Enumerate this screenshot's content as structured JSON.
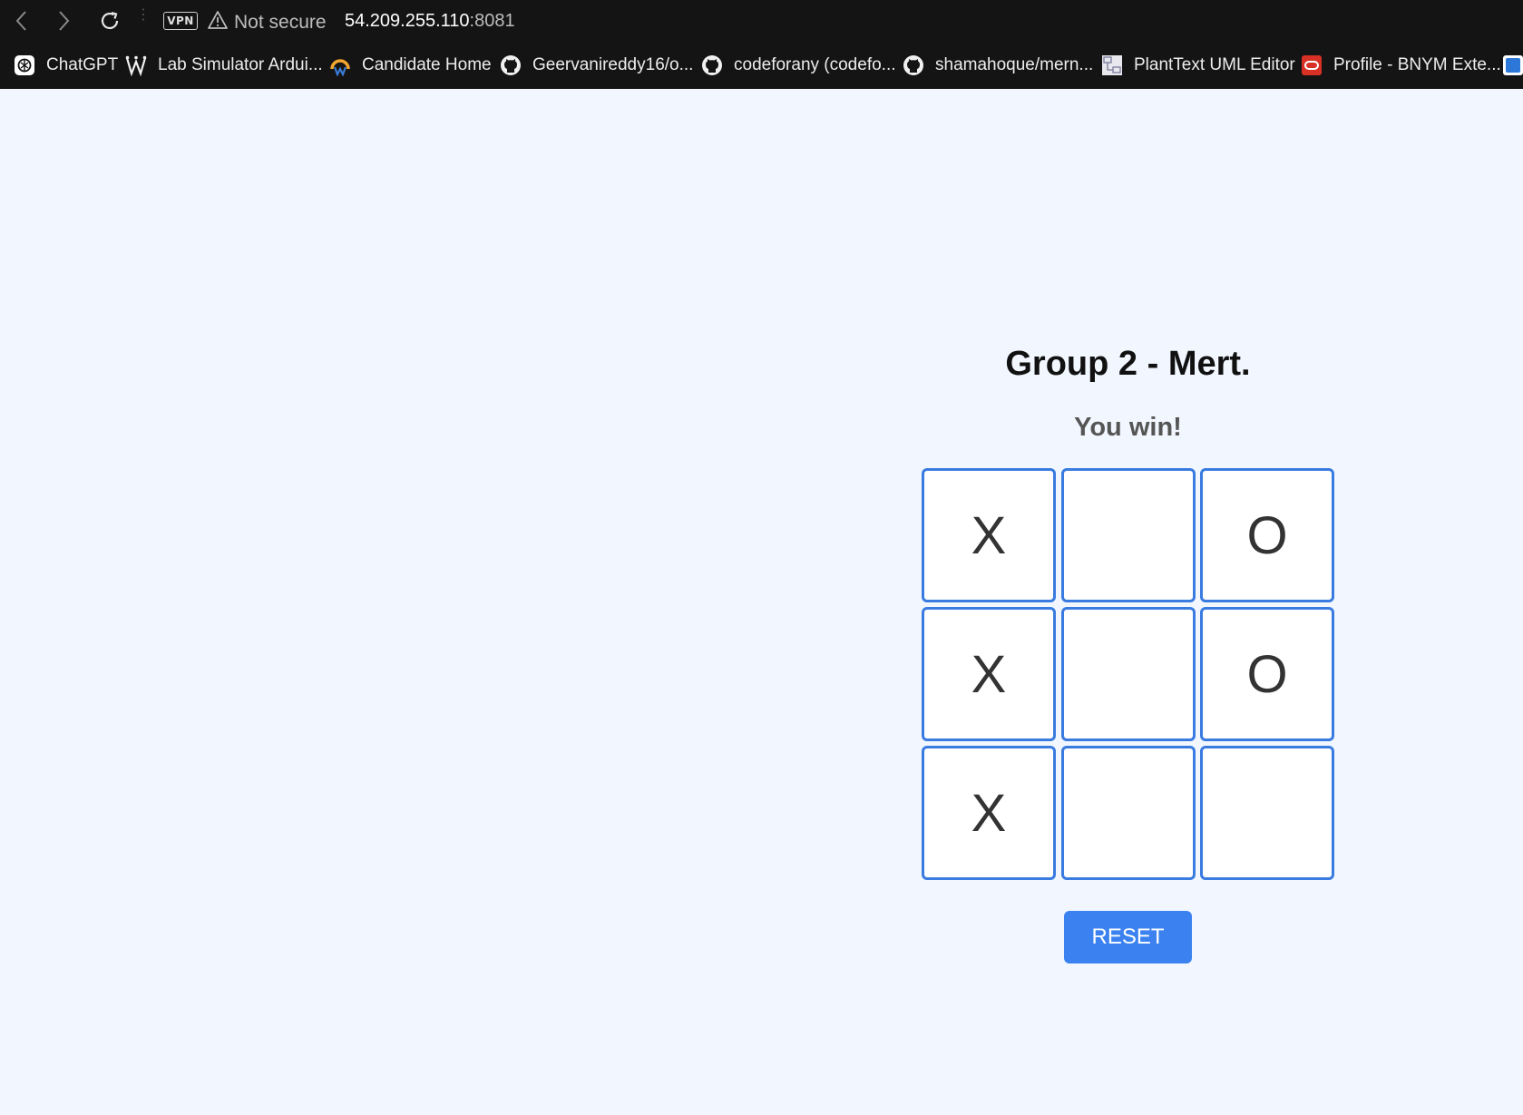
{
  "browser": {
    "vpn_label": "VPN",
    "security_text": "Not secure",
    "url_host": "54.209.255.110",
    "url_port": ":8081",
    "bookmarks": [
      {
        "label": "ChatGPT",
        "icon": "chatgpt-icon"
      },
      {
        "label": "Lab Simulator Ardui...",
        "icon": "w-logo-icon"
      },
      {
        "label": "Candidate Home",
        "icon": "candidate-logo-icon"
      },
      {
        "label": "Geervanireddy16/o...",
        "icon": "github-icon"
      },
      {
        "label": "codeforany (codefo...",
        "icon": "github-icon"
      },
      {
        "label": "shamahoque/mern...",
        "icon": "github-icon"
      },
      {
        "label": "PlantText UML Editor",
        "icon": "planttext-icon"
      },
      {
        "label": "Profile - BNYM Exte...",
        "icon": "oracle-icon"
      }
    ]
  },
  "game": {
    "title": "Group 2 - Mert.",
    "status": "You win!",
    "board": [
      "X",
      "",
      "O",
      "X",
      "",
      "O",
      "X",
      "",
      ""
    ],
    "reset_label": "RESET"
  },
  "colors": {
    "accent": "#3b82f0",
    "cell_border": "#3a7be0",
    "page_bg": "#f2f7ff",
    "chrome_bg": "#141414"
  }
}
